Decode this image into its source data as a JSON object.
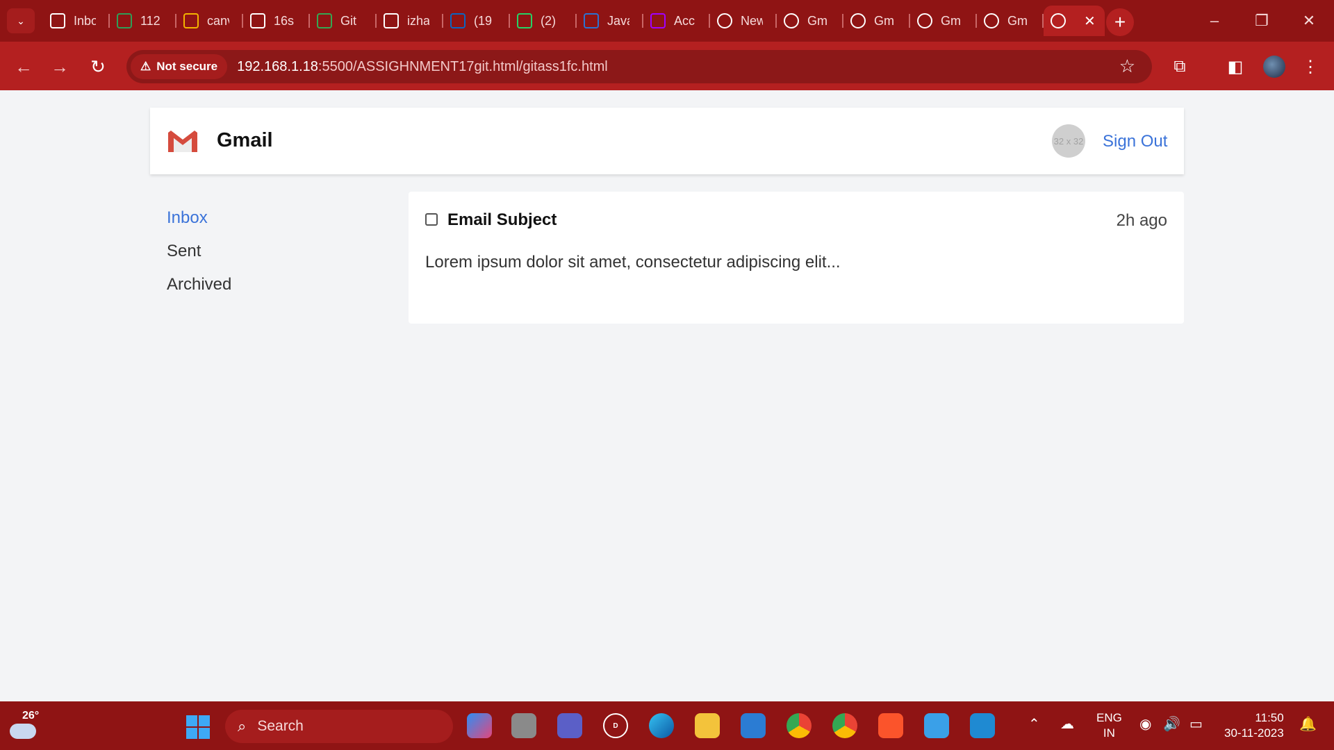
{
  "browser": {
    "tabs": [
      {
        "title": "Inbox",
        "favicon": "gmail-icon",
        "color": "#ffffff"
      },
      {
        "title": "112",
        "favicon": "sheets-icon",
        "color": "#2e9f58"
      },
      {
        "title": "canva",
        "favicon": "drive-triangle-icon",
        "color": "#f4b400"
      },
      {
        "title": "16s",
        "favicon": "wordpress-icon",
        "color": "#ffffff"
      },
      {
        "title": "Git",
        "favicon": "google-drive-icon",
        "color": "#34a853"
      },
      {
        "title": "izha",
        "favicon": "github-icon",
        "color": "#ffffff"
      },
      {
        "title": "(19",
        "favicon": "linkedin-icon",
        "color": "#0a66c2"
      },
      {
        "title": "(2)",
        "favicon": "whatsapp-icon",
        "color": "#25d366"
      },
      {
        "title": "Java",
        "favicon": "edu-icon",
        "color": "#2c72d2"
      },
      {
        "title": "Acc",
        "favicon": "accenture-icon",
        "color": "#a100ff"
      },
      {
        "title": "New",
        "favicon": "globe-icon",
        "color": "#ffffff"
      },
      {
        "title": "Gm",
        "favicon": "globe-icon",
        "color": "#ffffff"
      },
      {
        "title": "Gm",
        "favicon": "globe-icon",
        "color": "#ffffff"
      },
      {
        "title": "Gm",
        "favicon": "globe-icon",
        "color": "#ffffff"
      },
      {
        "title": "Gm",
        "favicon": "globe-icon",
        "color": "#ffffff"
      }
    ],
    "security_label": "Not secure",
    "url_host": "192.168.1.18",
    "url_path": ":5500/ASSIGHNMENT17git.html/gitass1fc.html"
  },
  "header": {
    "brand": "Gmail",
    "avatar_placeholder": "32 x 32",
    "sign_out": "Sign Out"
  },
  "sidebar": {
    "items": [
      {
        "label": "Inbox",
        "active": true
      },
      {
        "label": "Sent",
        "active": false
      },
      {
        "label": "Archived",
        "active": false
      }
    ]
  },
  "email": {
    "subject": "Email Subject",
    "time": "2h ago",
    "preview": "Lorem ipsum dolor sit amet, consectetur adipiscing elit..."
  },
  "taskbar": {
    "temperature": "26°",
    "search_label": "Search",
    "lang_top": "ENG",
    "lang_bottom": "IN",
    "time": "11:50",
    "date": "30-11-2023"
  },
  "colors": {
    "theme_red": "#b42020",
    "link_blue": "#3b73d9",
    "page_bg": "#f3f4f6"
  }
}
